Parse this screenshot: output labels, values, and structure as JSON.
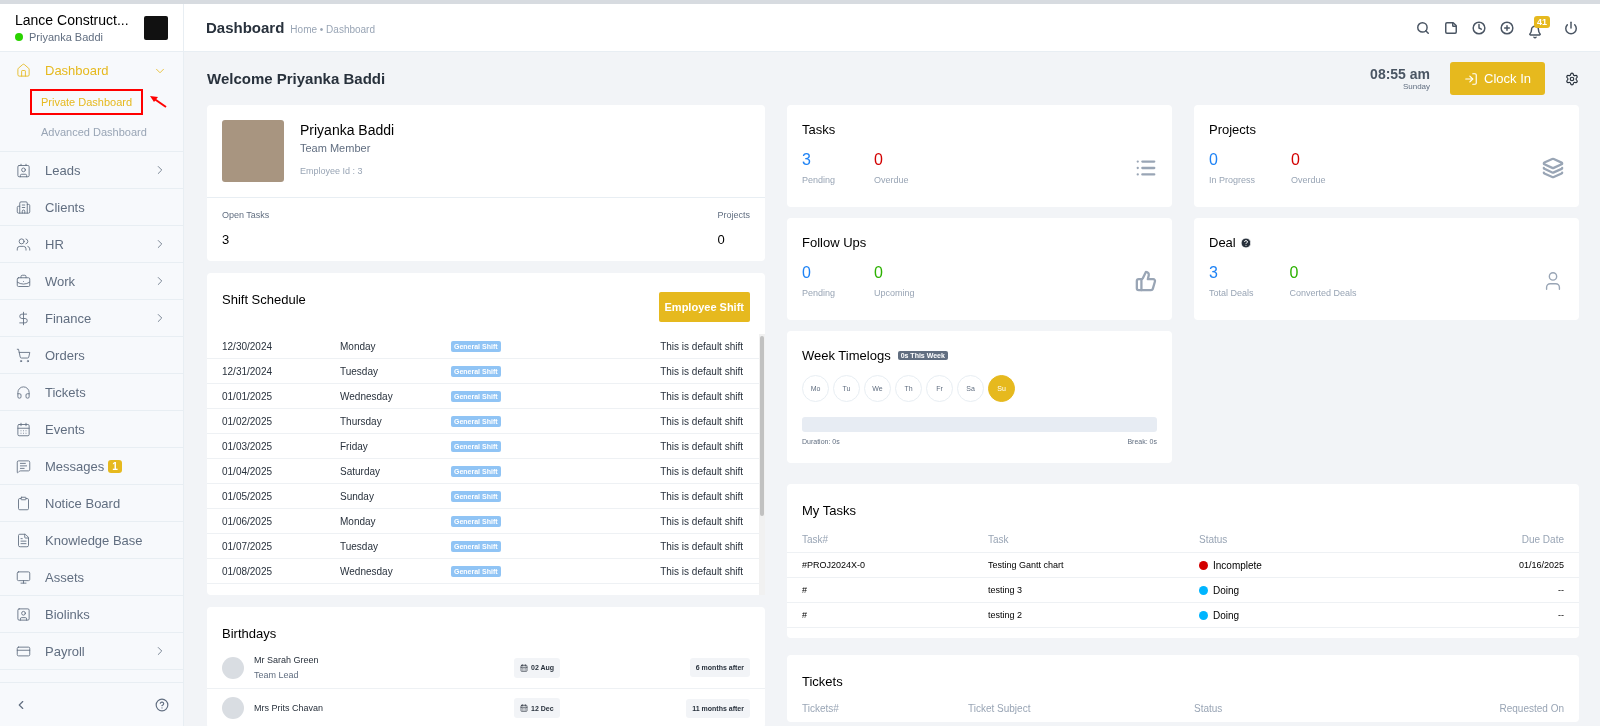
{
  "sidebar": {
    "company": "Lance Construct...",
    "user": "Priyanka Baddi",
    "online": true,
    "items": [
      {
        "label": "Dashboard",
        "expanded": true,
        "active": true,
        "has_children": true,
        "children": [
          {
            "label": "Private Dashboard",
            "selected": true,
            "annotated": true
          },
          {
            "label": "Advanced Dashboard",
            "selected": false,
            "annotated": false
          }
        ]
      },
      {
        "label": "Leads",
        "expanded": false,
        "active": false,
        "has_children": true
      },
      {
        "label": "Clients",
        "expanded": false,
        "active": false,
        "has_children": false
      },
      {
        "label": "HR",
        "expanded": false,
        "active": false,
        "has_children": true
      },
      {
        "label": "Work",
        "expanded": false,
        "active": false,
        "has_children": true
      },
      {
        "label": "Finance",
        "expanded": false,
        "active": false,
        "has_children": true
      },
      {
        "label": "Orders",
        "expanded": false,
        "active": false,
        "has_children": false
      },
      {
        "label": "Tickets",
        "expanded": false,
        "active": false,
        "has_children": false
      },
      {
        "label": "Events",
        "expanded": false,
        "active": false,
        "has_children": false
      },
      {
        "label": "Messages",
        "expanded": false,
        "active": false,
        "has_children": false,
        "badge": "1"
      },
      {
        "label": "Notice Board",
        "expanded": false,
        "active": false,
        "has_children": false
      },
      {
        "label": "Knowledge Base",
        "expanded": false,
        "active": false,
        "has_children": false
      },
      {
        "label": "Assets",
        "expanded": false,
        "active": false,
        "has_children": false
      },
      {
        "label": "Biolinks",
        "expanded": false,
        "active": false,
        "has_children": false
      },
      {
        "label": "Payroll",
        "expanded": false,
        "active": false,
        "has_children": true
      }
    ]
  },
  "header": {
    "title": "Dashboard",
    "breadcrumb": "Home • Dashboard",
    "notification_count": "41"
  },
  "welcome": {
    "title": "Welcome Priyanka Baddi",
    "time": "08:55 am",
    "day": "Sunday",
    "clock_in": "Clock In"
  },
  "profile": {
    "name": "Priyanka Baddi",
    "role": "Team Member",
    "employee_id": "Employee Id : 3",
    "stats": [
      {
        "label": "Open Tasks",
        "value": "3"
      },
      {
        "label": "Projects",
        "value": "0"
      }
    ]
  },
  "shift_schedule": {
    "title": "Shift Schedule",
    "button": "Employee Shift",
    "rows": [
      {
        "date": "12/30/2024",
        "day": "Monday",
        "shift": "General Shift",
        "remark": "This is default shift"
      },
      {
        "date": "12/31/2024",
        "day": "Tuesday",
        "shift": "General Shift",
        "remark": "This is default shift"
      },
      {
        "date": "01/01/2025",
        "day": "Wednesday",
        "shift": "General Shift",
        "remark": "This is default shift"
      },
      {
        "date": "01/02/2025",
        "day": "Thursday",
        "shift": "General Shift",
        "remark": "This is default shift"
      },
      {
        "date": "01/03/2025",
        "day": "Friday",
        "shift": "General Shift",
        "remark": "This is default shift"
      },
      {
        "date": "01/04/2025",
        "day": "Saturday",
        "shift": "General Shift",
        "remark": "This is default shift"
      },
      {
        "date": "01/05/2025",
        "day": "Sunday",
        "shift": "General Shift",
        "remark": "This is default shift"
      },
      {
        "date": "01/06/2025",
        "day": "Monday",
        "shift": "General Shift",
        "remark": "This is default shift"
      },
      {
        "date": "01/07/2025",
        "day": "Tuesday",
        "shift": "General Shift",
        "remark": "This is default shift"
      },
      {
        "date": "01/08/2025",
        "day": "Wednesday",
        "shift": "General Shift",
        "remark": "This is default shift"
      }
    ]
  },
  "birthdays": {
    "title": "Birthdays",
    "rows": [
      {
        "name": "Mr Sarah Green",
        "role": "Team Lead",
        "date": "02 Aug",
        "when": "6 months after"
      },
      {
        "name": "Mrs Prits Chavan",
        "date": "12 Dec",
        "when": "11 months after"
      }
    ]
  },
  "stat_cards": [
    {
      "title": "Tasks",
      "help": false,
      "stats": [
        {
          "value": "3",
          "label": "Pending",
          "color": "#1d82f5"
        },
        {
          "value": "0",
          "label": "Overdue",
          "color": "#d30000"
        }
      ]
    },
    {
      "title": "Projects",
      "help": false,
      "stats": [
        {
          "value": "0",
          "label": "In Progress",
          "color": "#1d82f5"
        },
        {
          "value": "0",
          "label": "Overdue",
          "color": "#d30000"
        }
      ]
    },
    {
      "title": "Follow Ups",
      "help": false,
      "stats": [
        {
          "value": "0",
          "label": "Pending",
          "color": "#1d82f5"
        },
        {
          "value": "0",
          "label": "Upcoming",
          "color": "#2cb100"
        }
      ]
    },
    {
      "title": "Deal",
      "help": true,
      "stats": [
        {
          "value": "3",
          "label": "Total Deals",
          "color": "#1d82f5"
        },
        {
          "value": "0",
          "label": "Converted Deals",
          "color": "#2cb100"
        }
      ]
    }
  ],
  "week_timelogs": {
    "title": "Week Timelogs",
    "badge": "0s This Week",
    "days": [
      {
        "label": "Mo",
        "selected": false
      },
      {
        "label": "Tu",
        "selected": false
      },
      {
        "label": "We",
        "selected": false
      },
      {
        "label": "Th",
        "selected": false
      },
      {
        "label": "Fr",
        "selected": false
      },
      {
        "label": "Sa",
        "selected": false
      },
      {
        "label": "Su",
        "selected": true
      }
    ],
    "duration": "Duration: 0s",
    "break": "Break: 0s"
  },
  "my_tasks": {
    "title": "My Tasks",
    "columns": [
      "Task#",
      "Task",
      "Status",
      "Due Date"
    ],
    "rows": [
      {
        "number": "#PROJ2024X-0",
        "task": "Testing Gantt chart",
        "status": "Incomplete",
        "color": "#d30000",
        "due": "01/16/2025"
      },
      {
        "number": "#",
        "task": "testing 3",
        "status": "Doing",
        "color": "#00b5ff",
        "due": "--"
      },
      {
        "number": "#",
        "task": "testing 2",
        "status": "Doing",
        "color": "#00b5ff",
        "due": "--"
      }
    ]
  },
  "tickets": {
    "title": "Tickets",
    "columns": [
      "Tickets#",
      "Ticket Subject",
      "Status",
      "Requested On"
    ]
  }
}
